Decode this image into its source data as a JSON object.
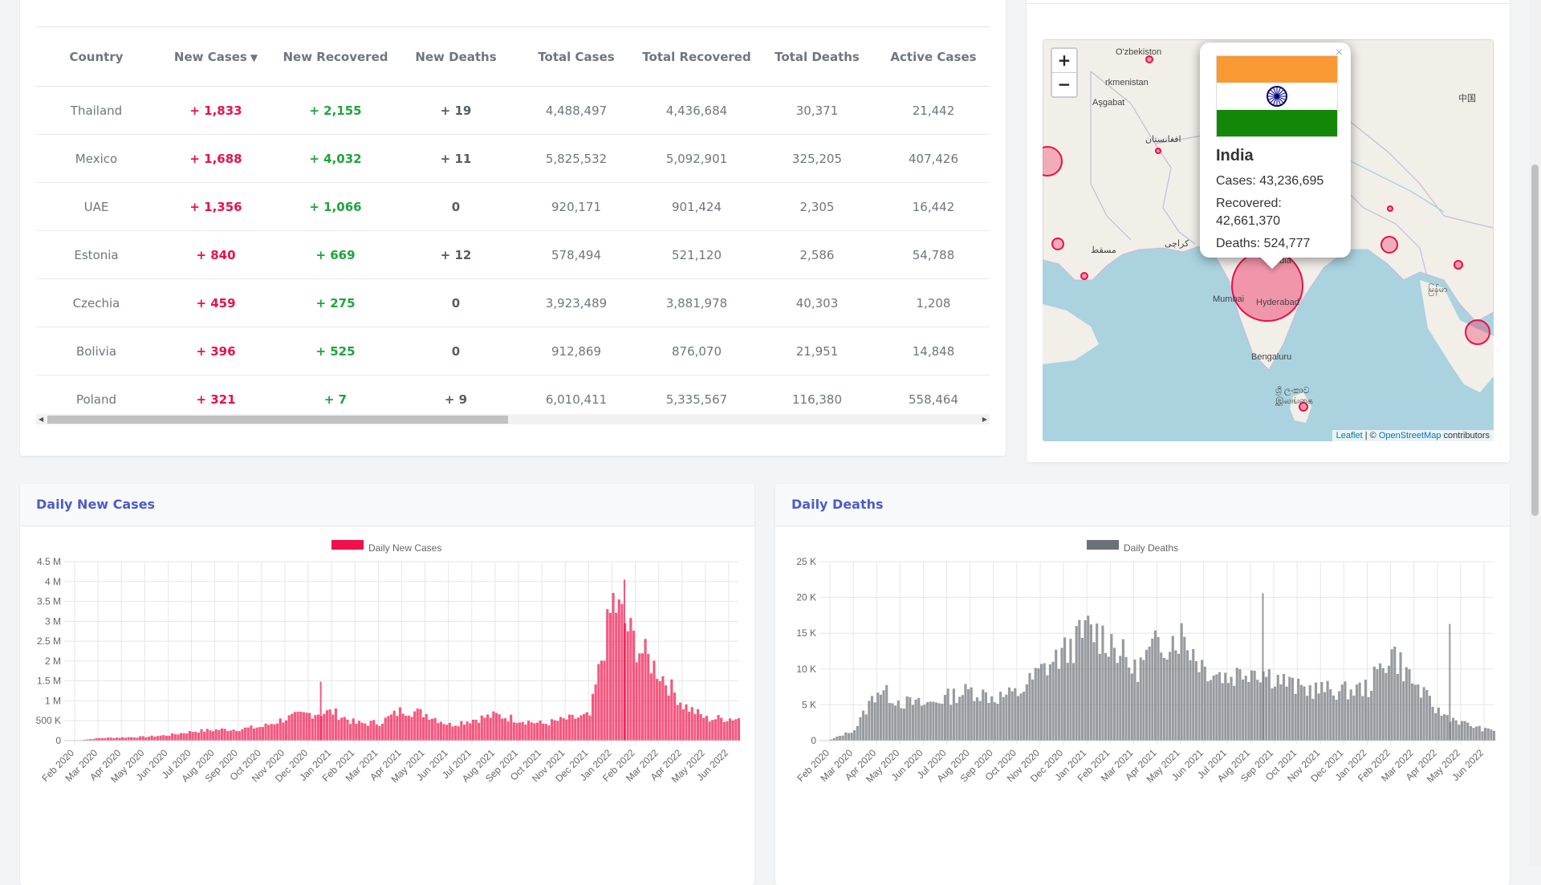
{
  "table": {
    "columns": [
      "Country",
      "New Cases",
      "New Recovered",
      "New Deaths",
      "Total Cases",
      "Total Recovered",
      "Total Deaths",
      "Active Cases"
    ],
    "sort_indicator": "▼",
    "rows": [
      {
        "country": "Thailand",
        "new_cases": "+ 1,833",
        "new_recovered": "+ 2,155",
        "new_deaths": "+ 19",
        "total_cases": "4,488,497",
        "total_recovered": "4,436,684",
        "total_deaths": "30,371",
        "active_cases": "21,442"
      },
      {
        "country": "Mexico",
        "new_cases": "+ 1,688",
        "new_recovered": "+ 4,032",
        "new_deaths": "+ 11",
        "total_cases": "5,825,532",
        "total_recovered": "5,092,901",
        "total_deaths": "325,205",
        "active_cases": "407,426"
      },
      {
        "country": "UAE",
        "new_cases": "+ 1,356",
        "new_recovered": "+ 1,066",
        "new_deaths": "0",
        "total_cases": "920,171",
        "total_recovered": "901,424",
        "total_deaths": "2,305",
        "active_cases": "16,442"
      },
      {
        "country": "Estonia",
        "new_cases": "+ 840",
        "new_recovered": "+ 669",
        "new_deaths": "+ 12",
        "total_cases": "578,494",
        "total_recovered": "521,120",
        "total_deaths": "2,586",
        "active_cases": "54,788"
      },
      {
        "country": "Czechia",
        "new_cases": "+ 459",
        "new_recovered": "+ 275",
        "new_deaths": "0",
        "total_cases": "3,923,489",
        "total_recovered": "3,881,978",
        "total_deaths": "40,303",
        "active_cases": "1,208"
      },
      {
        "country": "Bolivia",
        "new_cases": "+ 396",
        "new_recovered": "+ 525",
        "new_deaths": "0",
        "total_cases": "912,869",
        "total_recovered": "876,070",
        "total_deaths": "21,951",
        "active_cases": "14,848"
      },
      {
        "country": "Poland",
        "new_cases": "+ 321",
        "new_recovered": "+ 7",
        "new_deaths": "+ 9",
        "total_cases": "6,010,411",
        "total_recovered": "5,335,567",
        "total_deaths": "116,380",
        "active_cases": "558,464"
      }
    ]
  },
  "map": {
    "zoom_in": "+",
    "zoom_out": "−",
    "popup": {
      "close": "×",
      "title": "India",
      "cases_label": "Cases:",
      "cases": "43,236,695",
      "recovered_label": "Recovered:",
      "recovered": "42,661,370",
      "deaths_label": "Deaths:",
      "deaths": "524,777"
    },
    "attribution": {
      "leaflet": "Leaflet",
      "sep": " | © ",
      "osm": "OpenStreetMap",
      "contributors": " contributors"
    },
    "labels": {
      "uzbekistan": "O'zbekiston",
      "turkmenistan": "rkmenistan",
      "asgabat": "Aşgabat",
      "afghanistan": "افغانستان",
      "muscat": "مسقط",
      "karachi": "کراچی",
      "india": "India",
      "mumbai": "Mumbai",
      "hyderabad": "Hyderabad",
      "bengaluru": "Bengaluru",
      "srilanka": "ශ්‍රී ලංකාව\nஇலங்கை",
      "myanmar": "မြန်မာ",
      "china": "中国"
    }
  },
  "colors": {
    "cases": "#f0114a",
    "deaths": "#6b7178",
    "map_marker": "#e8114a",
    "title": "#4e5cc7"
  },
  "charts": {
    "cases_title": "Daily New Cases",
    "deaths_title": "Daily Deaths"
  },
  "chart_data": [
    {
      "type": "bar",
      "title": "Daily New Cases",
      "legend": "Daily New Cases",
      "legend_position": "top",
      "grid": true,
      "ylim": [
        0,
        4500000
      ],
      "yticks": [
        "0",
        "500 K",
        "1 M",
        "1.5 M",
        "2 M",
        "2.5 M",
        "3 M",
        "3.5 M",
        "4 M",
        "4.5 M"
      ],
      "xticks": [
        "Feb 2020",
        "Mar 2020",
        "Apr 2020",
        "May 2020",
        "Jun 2020",
        "Jul 2020",
        "Aug 2020",
        "Sep 2020",
        "Oct 2020",
        "Nov 2020",
        "Dec 2020",
        "Jan 2021",
        "Feb 2021",
        "Mar 2021",
        "Apr 2021",
        "May 2021",
        "Jun 2021",
        "Jul 2021",
        "Aug 2021",
        "Sep 2021",
        "Oct 2021",
        "Nov 2021",
        "Dec 2021",
        "Jan 2022",
        "Feb 2022",
        "Mar 2022",
        "Apr 2022",
        "May 2022",
        "Jun 2022"
      ],
      "series": [
        {
          "name": "Daily New Cases",
          "monthly_typical_values": [
            1000,
            60000,
            80000,
            95000,
            140000,
            230000,
            270000,
            290000,
            350000,
            560000,
            680000,
            720000,
            430000,
            450000,
            780000,
            670000,
            400000,
            530000,
            640000,
            520000,
            420000,
            540000,
            620000,
            3500000,
            2400000,
            1700000,
            900000,
            550000,
            560000
          ],
          "peak_spikes": [
            {
              "date": "Dec 2020",
              "value": 1480000
            },
            {
              "date": "Jan 2022",
              "value": 4050000
            }
          ]
        }
      ]
    },
    {
      "type": "bar",
      "title": "Daily Deaths",
      "legend": "Daily Deaths",
      "legend_position": "top",
      "grid": true,
      "ylim": [
        0,
        25000
      ],
      "yticks": [
        "0",
        "5 K",
        "10 K",
        "15 K",
        "20 K",
        "25 K"
      ],
      "xticks": [
        "Feb 2020",
        "Mar 2020",
        "Apr 2020",
        "May 2020",
        "Jun 2020",
        "Jul 2020",
        "Aug 2020",
        "Sep 2020",
        "Oct 2020",
        "Nov 2020",
        "Dec 2020",
        "Jan 2021",
        "Feb 2021",
        "Mar 2021",
        "Apr 2021",
        "May 2021",
        "Jun 2021",
        "Jul 2021",
        "Aug 2021",
        "Sep 2021",
        "Oct 2021",
        "Nov 2021",
        "Dec 2021",
        "Jan 2022",
        "Feb 2022",
        "Mar 2022",
        "Apr 2022",
        "May 2022",
        "Jun 2022"
      ],
      "series": [
        {
          "name": "Daily Deaths",
          "monthly_typical_values": [
            150,
            1500,
            7200,
            5400,
            5000,
            6100,
            7000,
            6000,
            6600,
            9800,
            12300,
            15500,
            14000,
            9700,
            13500,
            14800,
            10200,
            8800,
            10200,
            8900,
            7300,
            7100,
            6900,
            7400,
            12500,
            7800,
            4000,
            2500,
            1500
          ],
          "peak_spikes": [
            {
              "date": "Aug 2021",
              "value": 20600
            },
            {
              "date": "Apr 2022",
              "value": 16300
            }
          ]
        }
      ]
    }
  ]
}
